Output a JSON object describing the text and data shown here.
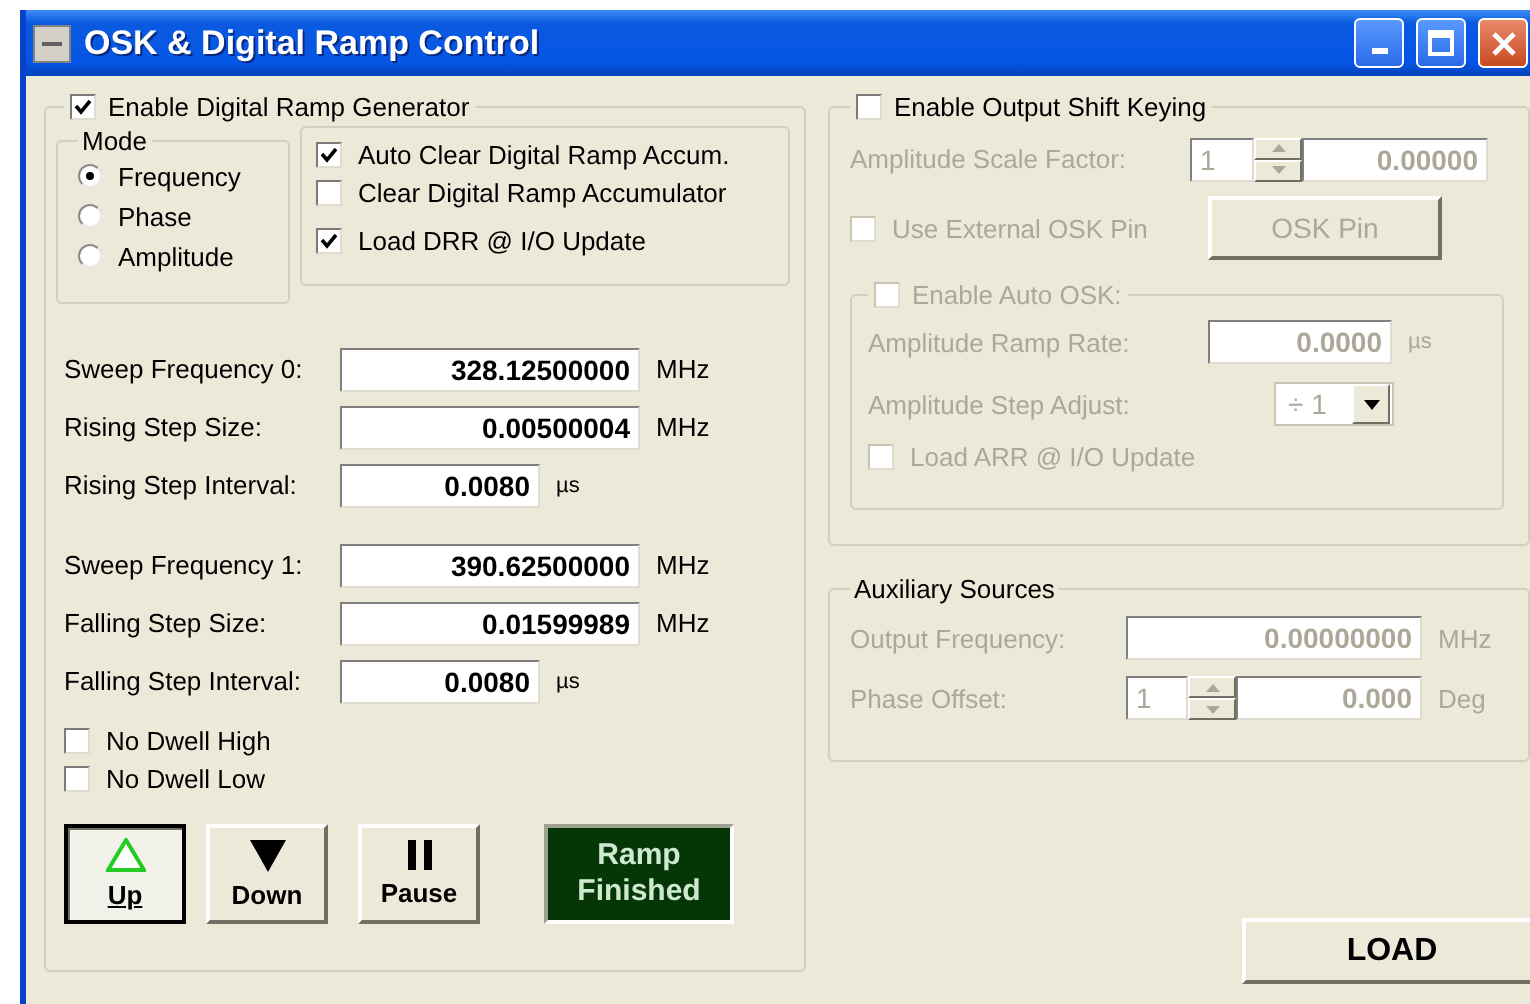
{
  "window": {
    "title": "OSK & Digital Ramp Control"
  },
  "ramp": {
    "enable": {
      "label": "Enable Digital Ramp Generator",
      "checked": true
    },
    "mode": {
      "title": "Mode",
      "options": [
        {
          "label": "Frequency",
          "selected": true
        },
        {
          "label": "Phase",
          "selected": false
        },
        {
          "label": "Amplitude",
          "selected": false
        }
      ]
    },
    "options": [
      {
        "label": "Auto Clear Digital Ramp Accum.",
        "checked": true
      },
      {
        "label": "Clear Digital Ramp Accumulator",
        "checked": false
      },
      {
        "label": "Load DRR @ I/O Update",
        "checked": true
      }
    ],
    "field_groups": [
      {
        "fields": [
          {
            "label": "Sweep Frequency 0:",
            "value": "328.12500000",
            "unit": "MHz",
            "kind": "wide"
          },
          {
            "label": "Rising Step Size:",
            "value": "0.00500004",
            "unit": "MHz",
            "kind": "wide"
          },
          {
            "label": "Rising Step Interval:",
            "value": "0.0080",
            "unit": "µs",
            "kind": "narrow"
          }
        ]
      },
      {
        "fields": [
          {
            "label": "Sweep Frequency 1:",
            "value": "390.62500000",
            "unit": "MHz",
            "kind": "wide"
          },
          {
            "label": "Falling Step Size:",
            "value": "0.01599989",
            "unit": "MHz",
            "kind": "wide"
          },
          {
            "label": "Falling Step Interval:",
            "value": "0.0080",
            "unit": "µs",
            "kind": "narrow"
          }
        ]
      }
    ],
    "dwell": [
      {
        "label": "No Dwell High",
        "checked": false
      },
      {
        "label": "No Dwell Low",
        "checked": false
      }
    ],
    "buttons": [
      {
        "label": "Up",
        "kind": "up",
        "selected": true
      },
      {
        "label": "Down",
        "kind": "down",
        "selected": false
      },
      {
        "label": "Pause",
        "kind": "pause",
        "selected": false
      }
    ],
    "status": {
      "label": "Ramp Finished"
    }
  },
  "osk": {
    "enable": {
      "label": "Enable Output Shift Keying",
      "checked": false
    },
    "scale_factor": {
      "label": "Amplitude Scale Factor:",
      "spin_value": "1",
      "value": "0.00000",
      "disabled": true
    },
    "external_pin": {
      "label": "Use External OSK Pin",
      "checked": false,
      "disabled": true
    },
    "pin_button": {
      "label": "OSK Pin",
      "disabled": true
    },
    "auto_osk": {
      "label": "Enable Auto OSK:",
      "checked": false,
      "disabled": true,
      "ramp_rate": {
        "label": "Amplitude Ramp Rate:",
        "value": "0.0000",
        "unit": "µs"
      },
      "step_adjust": {
        "label": "Amplitude Step Adjust:",
        "value": "÷ 1"
      },
      "load_arr": {
        "label": "Load ARR @ I/O Update",
        "checked": false
      }
    }
  },
  "aux": {
    "title": "Auxiliary Sources",
    "disabled": true,
    "fields": [
      {
        "label": "Output Frequency:",
        "value": "0.00000000",
        "unit": "MHz",
        "kind": "text"
      },
      {
        "label": "Phase Offset:",
        "spin_value": "1",
        "value": "0.000",
        "unit": "Deg",
        "kind": "spin"
      }
    ]
  },
  "load_button": {
    "label": "LOAD"
  }
}
